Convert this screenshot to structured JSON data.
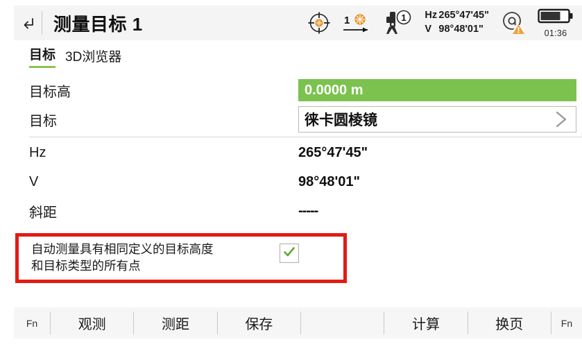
{
  "header": {
    "back_icon": "back-arrow-icon",
    "title": "测量目标 1",
    "status": {
      "target_icon": "crosshair-target-icon",
      "prism_mode_icon": "prism-direction-icon",
      "prism_mode_number": "1",
      "instrument_icon": "total-station-icon",
      "instrument_face": "1",
      "hz_label": "Hz",
      "hz_value": "265°47'45\"",
      "v_label": "V",
      "v_value": "98°48'01\"",
      "connection_icon": "at-warning-icon",
      "battery_icon": "battery-icon",
      "battery_time": "01:36",
      "battery_level_percent": 68
    }
  },
  "tabs": [
    {
      "label": "目标",
      "active": true
    },
    {
      "label": "3D浏览器",
      "active": false
    }
  ],
  "form": {
    "target_height": {
      "label": "目标高",
      "value": "0.0000 m",
      "field_color": "#7bc24f"
    },
    "target": {
      "label": "目标",
      "value": "徕卡圆棱镜",
      "chevron_icon": "chevron-right-icon"
    },
    "hz": {
      "label": "Hz",
      "value": "265°47'45\""
    },
    "v": {
      "label": "V",
      "value": "98°48'01\""
    },
    "slope_distance": {
      "label": "斜距",
      "value": "-----"
    }
  },
  "auto_measure": {
    "text_line1": "自动测量具有相同定义的目标高度",
    "text_line2": "和目标类型的所有点",
    "checked": true,
    "check_icon": "checkmark-icon",
    "highlight_color": "#e21b14"
  },
  "toolbar": {
    "fn_left": "Fn",
    "buttons": [
      "观测",
      "测距",
      "保存"
    ],
    "buttons_right": [
      "计算",
      "换页"
    ],
    "fn_right": "Fn"
  }
}
